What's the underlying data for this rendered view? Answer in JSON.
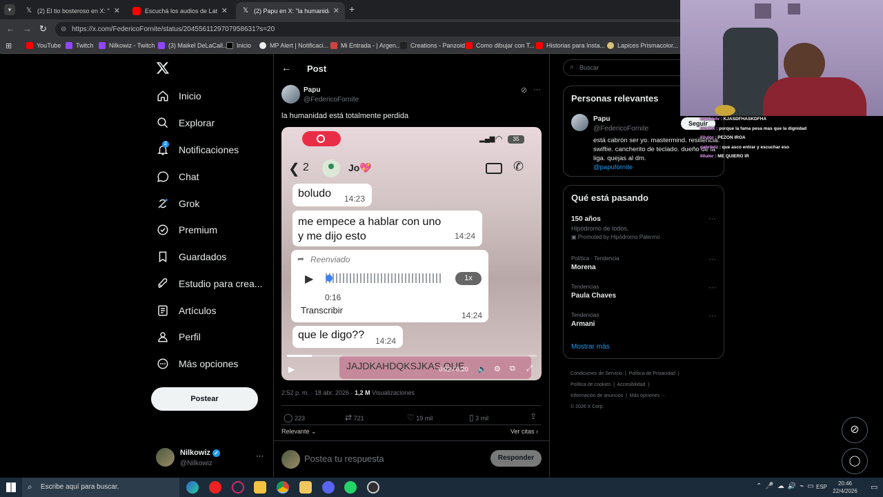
{
  "browser": {
    "tabs": [
      {
        "title": "(2) El tio bosteroso en X: \"Me de",
        "active": false,
        "favicon": "x-icon"
      },
      {
        "title": "Escuchá los audios de Latorre c",
        "active": false,
        "favicon": "youtube-icon"
      },
      {
        "title": "(2) Papu en X: \"la humanidad es",
        "active": true,
        "favicon": "x-icon"
      }
    ],
    "url": "https://x.com/FedericoFornite/status/2045561129707958631?s=20",
    "bookmarks": [
      "YouTube",
      "Twitch",
      "Nilkowiz - Twitch",
      "(3) Maikel DeLaCall...",
      "Inicio",
      "MP Alert | Notificaci...",
      "Mi Entrada - | Argen...",
      "Creations - Panzoid",
      "Como dibujar con T...",
      "Historias para Insta...",
      "Lapices Prismacolor..."
    ]
  },
  "sidebar": {
    "items": [
      {
        "label": "Inicio",
        "icon": "home-icon"
      },
      {
        "label": "Explorar",
        "icon": "search-icon"
      },
      {
        "label": "Notificaciones",
        "icon": "bell-icon",
        "badge": "2"
      },
      {
        "label": "Chat",
        "icon": "chat-icon"
      },
      {
        "label": "Grok",
        "icon": "grok-icon"
      },
      {
        "label": "Premium",
        "icon": "premium-icon"
      },
      {
        "label": "Guardados",
        "icon": "bookmark-icon"
      },
      {
        "label": "Estudio para crea...",
        "icon": "rocket-icon"
      },
      {
        "label": "Artículos",
        "icon": "article-icon"
      },
      {
        "label": "Perfil",
        "icon": "person-icon"
      },
      {
        "label": "Más opciones",
        "icon": "more-circle-icon"
      }
    ],
    "post_button": "Postear",
    "account": {
      "name": "Nilkowiz",
      "handle": "@Nilkowiz"
    }
  },
  "post": {
    "header": "Post",
    "author": "Papu",
    "handle": "@FedericoFornite",
    "text": "la humanidad está totalmente perdida",
    "timestamp": "2:52 p. m. · 18 abr. 2026 ·",
    "views_count": "1,2 M",
    "views_label": "Visualizaciones",
    "stats": {
      "replies": "223",
      "reposts": "721",
      "likes": "19 mil",
      "bookmarks": "3 mil"
    },
    "sort_label": "Relevante",
    "quotes_label": "Ver citas",
    "reply_placeholder": "Postea tu respuesta",
    "reply_button": "Responder"
  },
  "media": {
    "chat_count": "2",
    "chat_name": "Jo💖",
    "battery": "35",
    "messages": [
      {
        "text": "boludo",
        "time": "14:23"
      },
      {
        "text": "me empece a hablar con uno y me dijo esto",
        "time": "14:24"
      },
      {
        "text": "que le digo??",
        "time": "14:24"
      }
    ],
    "voice": {
      "forward_label": "Reenviado",
      "duration": "0:16",
      "speed": "1x",
      "transcribe": "Transcribir",
      "time": "14:24"
    },
    "caption": "JAJDKAHDQKSJKAS QUE",
    "video_time": "0:02 / 0:20",
    "progress": 0.1
  },
  "right": {
    "search_placeholder": "Buscar",
    "relevant_title": "Personas relevantes",
    "person": {
      "name": "Papu",
      "handle": "@FedericoFornite",
      "follow": "Seguir",
      "bio": "está cabrón ser yo. mastermind. resiliencia. swiftie. cancherito de teclado. dueño de la liga. quejas al dm.",
      "link": "@papufornite"
    },
    "trending_title": "Qué está pasando",
    "trends": [
      {
        "title": "150 años",
        "sub": "Hipódromo de todos.",
        "promo": "Promoted by Hipódromo Palermo"
      },
      {
        "meta": "Política · Tendencia",
        "title": "Morena"
      },
      {
        "meta": "Tendencias",
        "title": "Paula Chaves"
      },
      {
        "meta": "Tendencias",
        "title": "Armani"
      }
    ],
    "show_more": "Mostrar más",
    "footer": [
      "Condiciones de Servicio",
      "Política de Privacidad",
      "Política de cookies",
      "Accesibilidad",
      "Información de anuncios",
      "Más opciones ···",
      "© 2026 X Corp."
    ]
  },
  "stream_chat": [
    {
      "user": "maxidelv",
      "msg": "KJASDFHASKDFHA"
    },
    {
      "user": "fabrikk",
      "msg": "porque la fama pesa mas que la dignidad"
    },
    {
      "user": "llilulor",
      "msg": "PEZON IROA"
    },
    {
      "user": "gabriwiz",
      "msg": "que asco entrar y escuchar eso"
    },
    {
      "user": "llilulor",
      "msg": "ME QUIERO IR"
    }
  ],
  "taskbar": {
    "search_placeholder": "Escribe aquí para buscar.",
    "lang": "ESP",
    "time": "20:46",
    "date": "22/4/2026"
  },
  "colors": {
    "accent": "#1d9bf0",
    "bg": "#000000",
    "border": "#2f3336",
    "muted": "#71767b"
  }
}
